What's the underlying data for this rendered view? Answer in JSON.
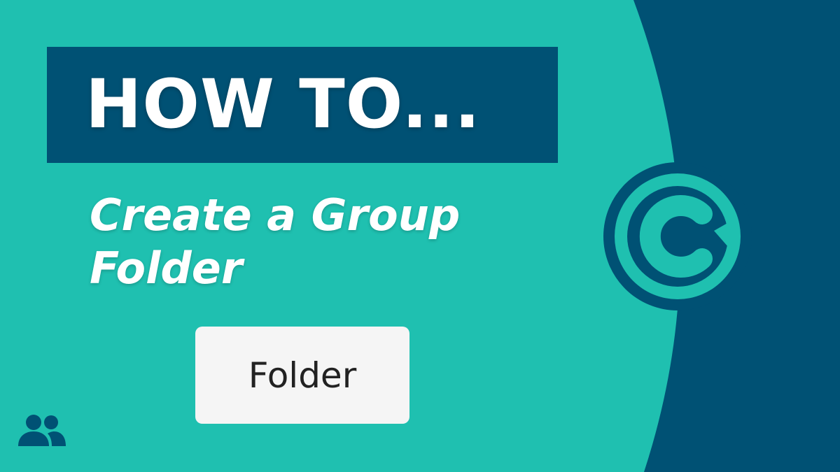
{
  "title": "HOW TO...",
  "subtitle_lines": [
    "Create a Group",
    "Folder"
  ],
  "folder_button_label": "Folder",
  "icons": {
    "logo": "c-brand-logo-icon",
    "users": "group-users-icon"
  },
  "colors": {
    "background_teal": "#1fc0b0",
    "dark_blue": "#005174",
    "white": "#ffffff",
    "button_bg": "#f5f5f5",
    "button_text": "#222222"
  }
}
